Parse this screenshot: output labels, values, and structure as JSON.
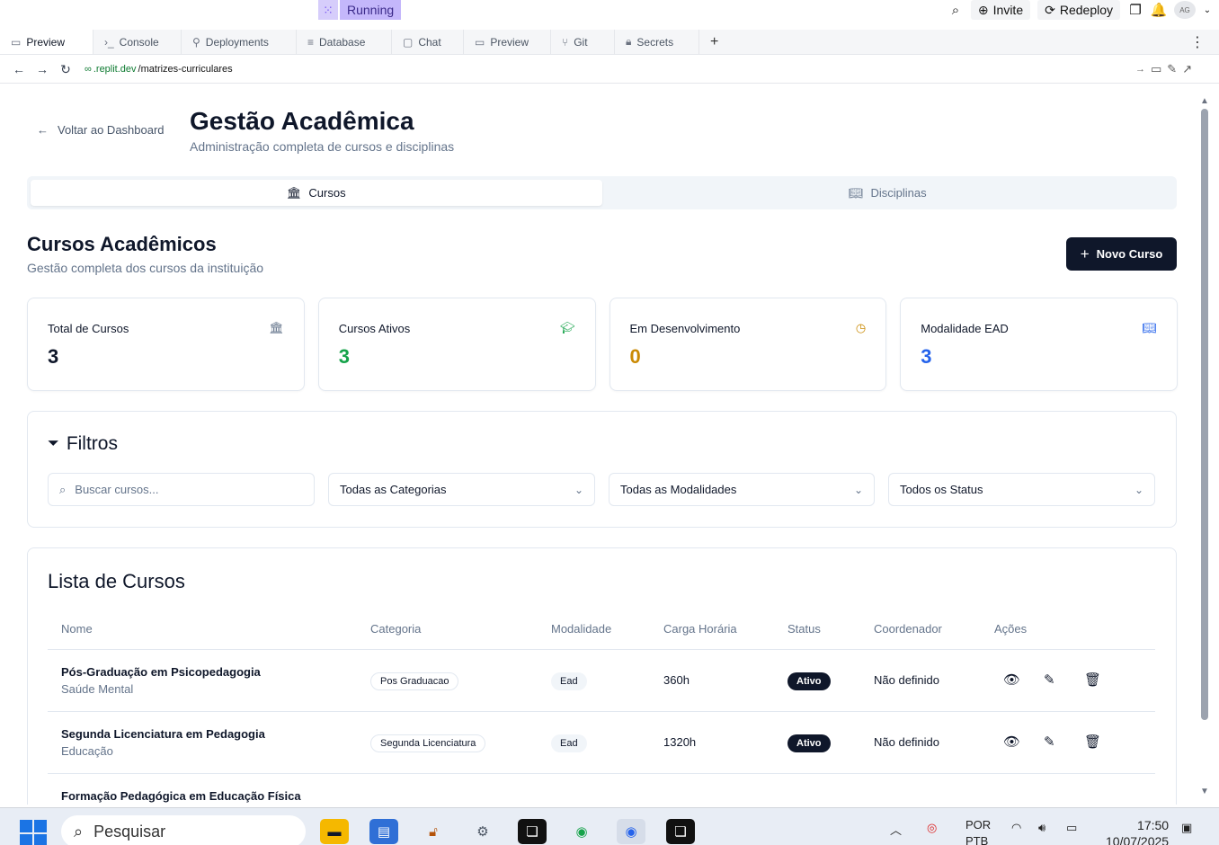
{
  "topbar": {
    "run_status": "Running",
    "invite": "Invite",
    "redeploy": "Redeploy",
    "avatar": "AG"
  },
  "tabs": [
    {
      "label": "Preview",
      "icon": "monitor-icon"
    },
    {
      "label": "Console",
      "icon": "terminal-icon"
    },
    {
      "label": "Deployments",
      "icon": "deploy-icon"
    },
    {
      "label": "Database",
      "icon": "database-icon"
    },
    {
      "label": "Chat",
      "icon": "chat-icon"
    },
    {
      "label": "Preview",
      "icon": "monitor-icon"
    },
    {
      "label": "Git",
      "icon": "git-icon"
    },
    {
      "label": "Secrets",
      "icon": "lock-icon"
    }
  ],
  "address": {
    "domain": ".replit.dev",
    "path": "/matrizes-curriculares"
  },
  "page": {
    "back_link": "Voltar ao Dashboard",
    "title": "Gestão Acadêmica",
    "subtitle": "Administração completa de cursos e disciplinas",
    "segments": [
      "Cursos",
      "Disciplinas"
    ],
    "section_title": "Cursos Acadêmicos",
    "section_subtitle": "Gestão completa dos cursos da instituição",
    "new_button": "Novo Curso"
  },
  "stats": [
    {
      "label": "Total de Cursos",
      "value": "3",
      "color": "#0f172a",
      "icon": "building-icon"
    },
    {
      "label": "Cursos Ativos",
      "value": "3",
      "color": "#16a34a",
      "icon": "graduation-cap-icon"
    },
    {
      "label": "Em Desenvolvimento",
      "value": "0",
      "color": "#ca8a04",
      "icon": "clock-icon"
    },
    {
      "label": "Modalidade EAD",
      "value": "3",
      "color": "#2563eb",
      "icon": "book-icon"
    }
  ],
  "filters": {
    "title": "Filtros",
    "search_placeholder": "Buscar cursos...",
    "categoria": "Todas as Categorias",
    "modalidade": "Todas as Modalidades",
    "status": "Todos os Status"
  },
  "table": {
    "title": "Lista de Cursos",
    "headers": [
      "Nome",
      "Categoria",
      "Modalidade",
      "Carga Horária",
      "Status",
      "Coordenador",
      "Ações"
    ],
    "rows": [
      {
        "name": "Pós-Graduação em Psicopedagogia",
        "area": "Saúde Mental",
        "categoria": "Pos Graduacao",
        "modalidade": "Ead",
        "carga": "360h",
        "status": "Ativo",
        "coordenador": "Não definido"
      },
      {
        "name": "Segunda Licenciatura em Pedagogia",
        "area": "Educação",
        "categoria": "Segunda Licenciatura",
        "modalidade": "Ead",
        "carga": "1320h",
        "status": "Ativo",
        "coordenador": "Não definido"
      },
      {
        "name": "Formação Pedagógica em Educação Física",
        "area": "",
        "categoria": "",
        "modalidade": "",
        "carga": "",
        "status": "",
        "coordenador": ""
      }
    ]
  },
  "taskbar": {
    "search": "Pesquisar",
    "lang1": "POR",
    "lang2": "PTB",
    "time": "17:50",
    "date": "10/07/2025"
  }
}
